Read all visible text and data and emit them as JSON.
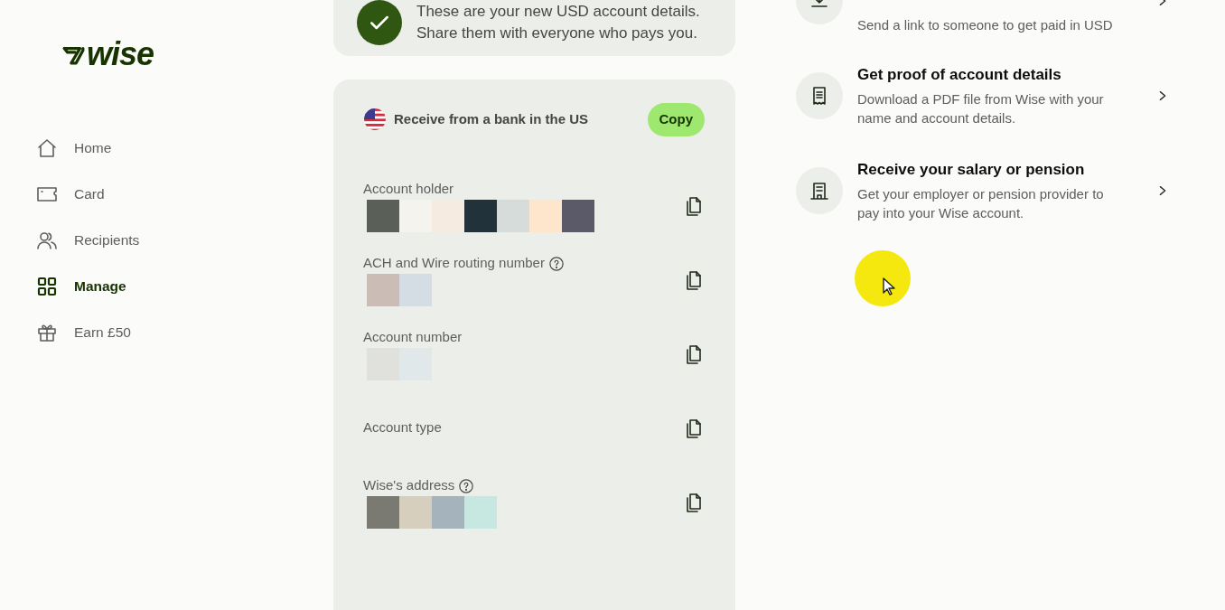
{
  "logo": {
    "text": "wise"
  },
  "nav": [
    {
      "label": "Home",
      "selected": false
    },
    {
      "label": "Card",
      "selected": false
    },
    {
      "label": "Recipients",
      "selected": false
    },
    {
      "label": "Manage",
      "selected": true
    },
    {
      "label": "Earn £50",
      "selected": false
    }
  ],
  "notice": {
    "lines": [
      "These are your new USD account details.",
      "Share them with everyone who pays you."
    ]
  },
  "details": {
    "title": "Receive from a bank in the US",
    "copy_button": "Copy",
    "fields": [
      {
        "label": "Account holder",
        "help": false,
        "mosaic": [
          {
            "color": "#5a5f58"
          },
          {
            "color": "#f4f3ee"
          },
          {
            "color": "#f5ebe0"
          },
          {
            "color": "#21323a"
          },
          {
            "color": "#d6dcda"
          },
          {
            "color": "#fde6cb"
          },
          {
            "color": "#5a5a68"
          }
        ]
      },
      {
        "label": "ACH and Wire routing number",
        "help": true,
        "mosaic": [
          {
            "color": "#cbbdb5"
          },
          {
            "color": "#d5dde4"
          }
        ]
      },
      {
        "label": "Account number",
        "help": false,
        "mosaic": [
          {
            "color": "#e0e0dc"
          },
          {
            "color": "#e0e8ea"
          }
        ]
      },
      {
        "label": "Account type",
        "help": false
      },
      {
        "label": "Wise's address",
        "help": true,
        "mosaic": [
          {
            "color": "#7b7a72"
          },
          {
            "color": "#d6cfbe"
          },
          {
            "color": "#a5b3bc"
          },
          {
            "color": "#c6e8e1"
          }
        ]
      }
    ]
  },
  "actions": [
    {
      "description": "Send a link to someone to get paid in USD"
    },
    {
      "title": "Get proof of account details",
      "description": "Download a PDF file from Wise with your name and account details."
    },
    {
      "title": "Receive your salary or pension",
      "description": "Get your employer or pension provider to pay into your Wise account."
    }
  ],
  "cursor": {
    "highlight": true
  }
}
